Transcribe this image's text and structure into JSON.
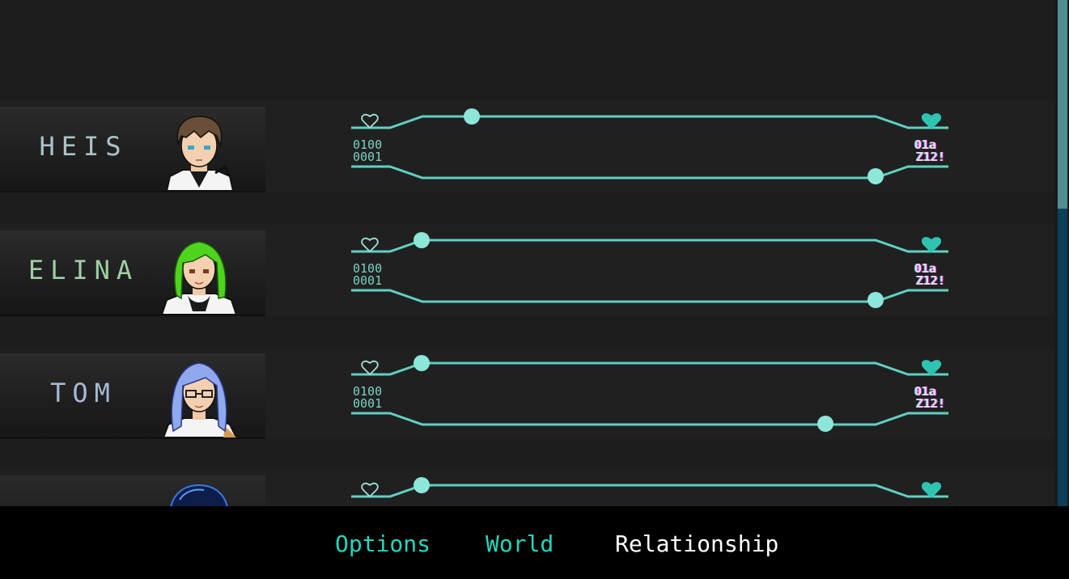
{
  "colors": {
    "accent": "#22d7bd",
    "track": "#5fd0c2",
    "knob": "#8ce6da",
    "active_tab": "#ffffff"
  },
  "labels": {
    "affection_icon_empty": "heart-outline-icon",
    "affection_icon_full": "heart-filled-icon",
    "trust_label_low_top": "0100",
    "trust_label_low_bottom": "0001",
    "trust_label_high_top": "01a",
    "trust_label_high_bottom": "Z12!"
  },
  "characters": [
    {
      "name": "HEIS",
      "affection": 0.2,
      "trust": 0.91
    },
    {
      "name": "ELINA",
      "affection": 0.12,
      "trust": 0.91
    },
    {
      "name": "TOM",
      "affection": 0.12,
      "trust": 0.82
    },
    {
      "name": "",
      "affection": 0.12,
      "trust": null
    }
  ],
  "nav": {
    "options": "Options",
    "world": "World",
    "relationship": "Relationship",
    "active": "relationship"
  },
  "scroll_position": 0.0
}
